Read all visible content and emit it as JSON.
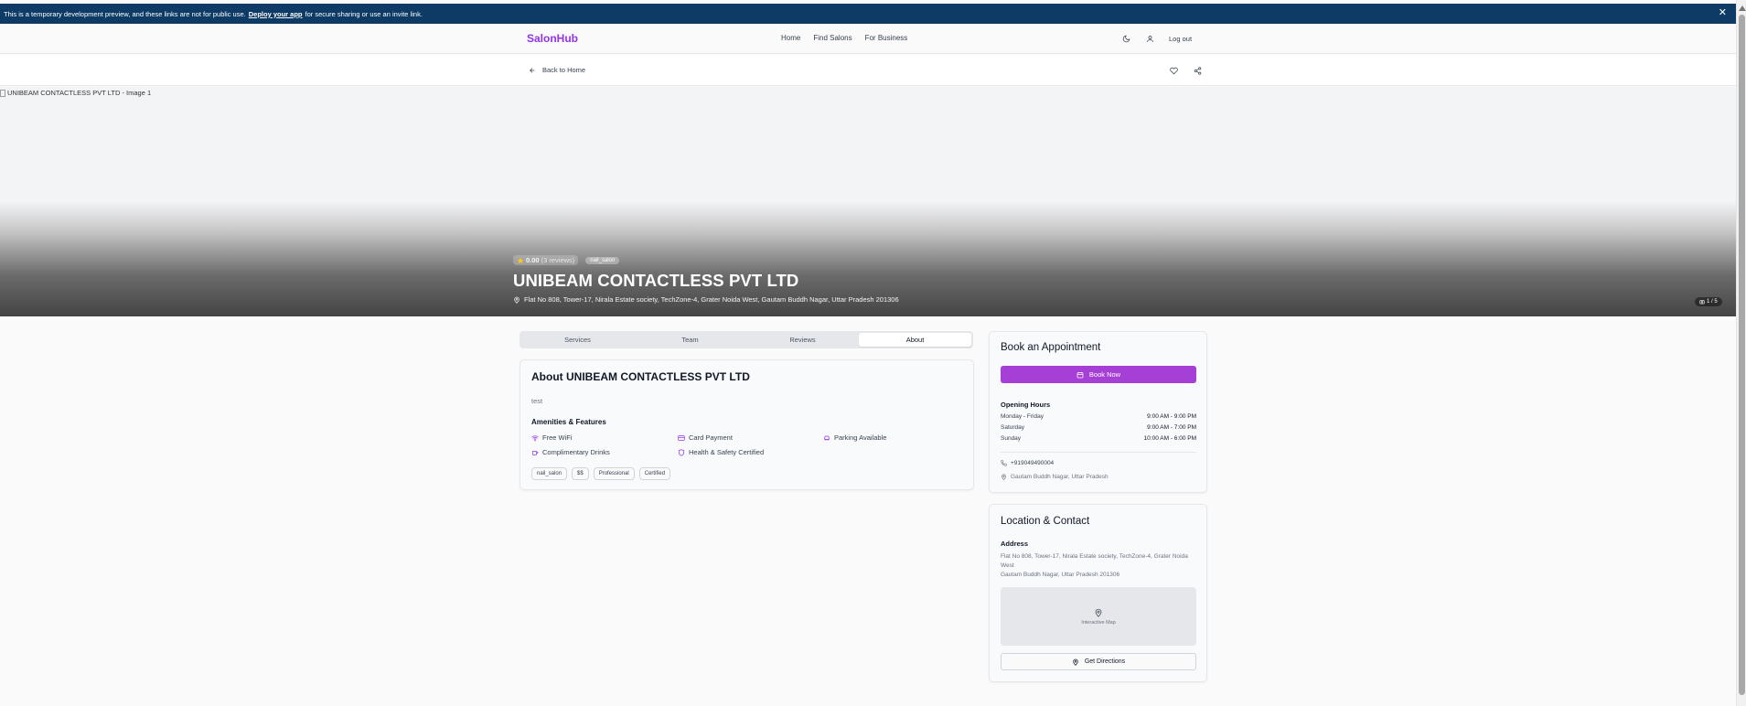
{
  "banner": {
    "text_before": "This is a temporary development preview, and these links are not for public use.",
    "link": "Deploy your app",
    "text_after": "for secure sharing or use an invite link.",
    "close": "✕"
  },
  "header": {
    "logo": "SalonHub",
    "nav": [
      "Home",
      "Find Salons",
      "For Business"
    ],
    "logout": "Log out"
  },
  "subnav": {
    "back": "Back to Home"
  },
  "hero": {
    "image_alt": "UNIBEAM CONTACTLESS PVT LTD - Image 1",
    "rating": "0.00",
    "reviews": "(3 reviews)",
    "category": "nail_salon",
    "title": "UNIBEAM CONTACTLESS PVT LTD",
    "address": "Flat No 808, Tower-17, Nirala Estate society, TechZone-4, Grater Noida West, Gautam Buddh Nagar, Uttar Pradesh 201306",
    "counter": "1 / 5"
  },
  "tabs": [
    "Services",
    "Team",
    "Reviews",
    "About"
  ],
  "about": {
    "title": "About UNIBEAM CONTACTLESS PVT LTD",
    "description": "test",
    "amenities_title": "Amenities & Features",
    "amenities": [
      "Free WiFi",
      "Card Payment",
      "Parking Available",
      "Complimentary Drinks",
      "Health & Safety Certified"
    ],
    "tags": [
      "nail_salon",
      "$$",
      "Professional",
      "Certified"
    ]
  },
  "booking": {
    "title": "Book an Appointment",
    "button": "Book Now",
    "hours_title": "Opening Hours",
    "hours": [
      {
        "day": "Monday - Friday",
        "time": "9:00 AM - 9:00 PM"
      },
      {
        "day": "Saturday",
        "time": "9:00 AM - 7:00 PM"
      },
      {
        "day": "Sunday",
        "time": "10:00 AM - 6:00 PM"
      }
    ],
    "phone": "+919049490004",
    "location": "Gautam Buddh Nagar, Uttar Pradesh"
  },
  "location": {
    "title": "Location & Contact",
    "address_title": "Address",
    "address_line1": "Flat No 808, Tower-17, Nirala Estate society, TechZone-4, Grater Noida West",
    "address_line2": "Gautam Buddh Nagar, Uttar Pradesh 201306",
    "map_label": "Interactive Map",
    "directions": "Get Directions"
  },
  "colors": {
    "brand": "#9333ea",
    "book_button": "#a63fd6",
    "banner": "#0d3b66",
    "star": "#facc15"
  }
}
